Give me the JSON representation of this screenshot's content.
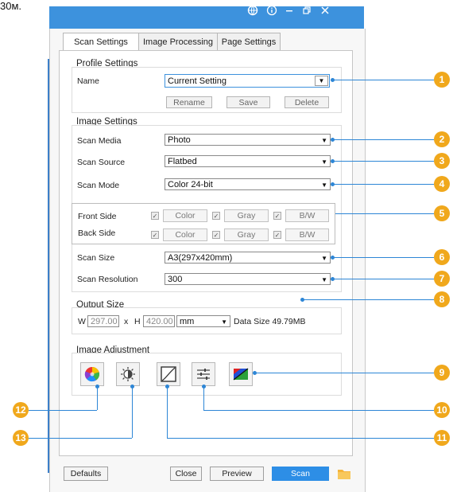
{
  "external_label": "30м.",
  "window": {
    "title_icons": [
      "globe-icon",
      "info-icon",
      "minimize-icon",
      "restore-icon",
      "close-icon"
    ],
    "accent": "#3d92dd"
  },
  "tabs": [
    {
      "label": "Scan Settings",
      "active": true
    },
    {
      "label": "Image Processing",
      "active": false
    },
    {
      "label": "Page Settings",
      "active": false
    }
  ],
  "profile": {
    "group_title": "Profile Settings",
    "name_label": "Name",
    "name_value": "Current Setting",
    "rename": "Rename",
    "save": "Save",
    "delete": "Delete"
  },
  "image_settings": {
    "group_title": "Image Settings",
    "scan_media_label": "Scan Media",
    "scan_media_value": "Photo",
    "scan_source_label": "Scan Source",
    "scan_source_value": "Flatbed",
    "scan_mode_label": "Scan Mode",
    "scan_mode_value": "Color 24-bit",
    "front_side_label": "Front Side",
    "back_side_label": "Back Side",
    "color_label": "Color",
    "gray_label": "Gray",
    "bw_label": "B/W",
    "scan_size_label": "Scan Size",
    "scan_size_value": "A3(297x420mm)",
    "scan_resolution_label": "Scan Resolution",
    "scan_resolution_value": "300"
  },
  "output_size": {
    "group_title": "Output Size",
    "w_label": "W",
    "w_value": "297.00",
    "x_label": "x",
    "h_label": "H",
    "h_value": "420.00",
    "unit": "mm",
    "data_size": "Data Size 49.79MB"
  },
  "image_adjustment": {
    "group_title": "Image Adjustment",
    "buttons": [
      "color-wheel-icon",
      "brightness-contrast-icon",
      "curve-icon",
      "levels-icon",
      "color-balance-icon"
    ]
  },
  "footer": {
    "defaults": "Defaults",
    "close": "Close",
    "preview": "Preview",
    "scan": "Scan"
  },
  "callouts": [
    "1",
    "2",
    "3",
    "4",
    "5",
    "6",
    "7",
    "8",
    "9",
    "10",
    "11",
    "12",
    "13"
  ],
  "callout_color": "#f0a81c"
}
